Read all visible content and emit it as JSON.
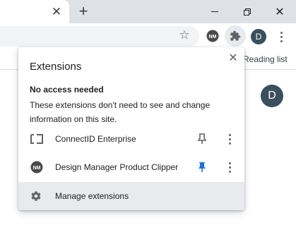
{
  "tabstrip": {
    "close_tab_glyph": "✕",
    "new_tab_glyph": "+",
    "window_close_glyph": "✕"
  },
  "toolbar": {
    "star_glyph": "☆",
    "extension_icon": "NM",
    "profile_initial": "D"
  },
  "bookmarks": {
    "reading_list_label": "Reading list"
  },
  "page": {
    "avatar_initial": "D"
  },
  "popup": {
    "title": "Extensions",
    "close_glyph": "✕",
    "section_title": "No access needed",
    "section_description": "These extensions don't need to see and change information on this site.",
    "extensions": [
      {
        "name": "ConnectID Enterprise",
        "icon": "connectid-icon",
        "pinned": false
      },
      {
        "name": "Design Manager Product Clipper",
        "icon": "nm-icon",
        "icon_text": "NM",
        "pinned": true
      }
    ],
    "manage_label": "Manage extensions"
  },
  "colors": {
    "pinned_blue": "#1a73e8",
    "unpinned_gray": "#5f6368",
    "avatar_bg": "#3b4f5c",
    "tabstrip_bg": "#dee1e6"
  }
}
